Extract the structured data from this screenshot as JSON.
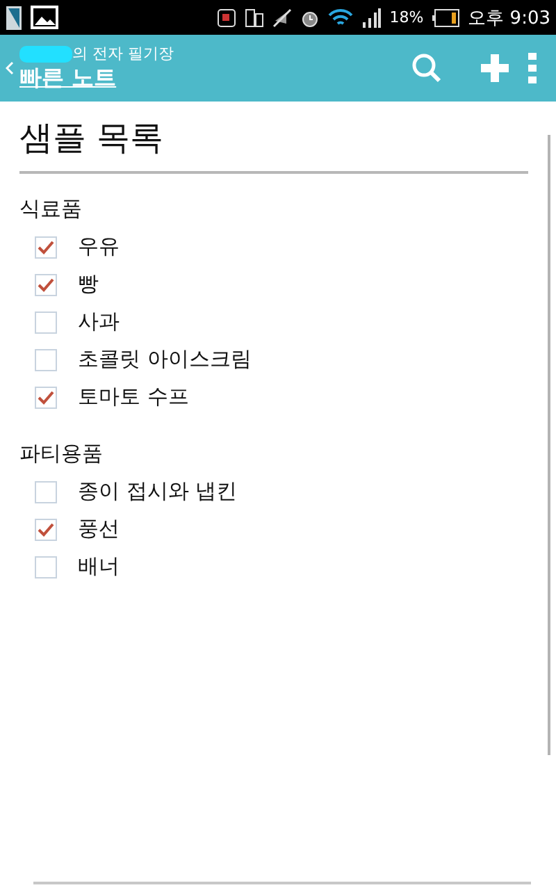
{
  "status_bar": {
    "battery": "18%",
    "time": "오후 9:03"
  },
  "app_bar": {
    "subtitle": "의 전자 필기장",
    "title": "빠른 노트"
  },
  "page": {
    "title": "샘플 목록"
  },
  "sections": [
    {
      "heading": "식료품",
      "items": [
        {
          "label": "우유",
          "checked": true
        },
        {
          "label": "빵",
          "checked": true
        },
        {
          "label": "사과",
          "checked": false
        },
        {
          "label": "초콜릿 아이스크림",
          "checked": false
        },
        {
          "label": "토마토 수프",
          "checked": true
        }
      ]
    },
    {
      "heading": "파티용품",
      "items": [
        {
          "label": "종이 접시와 냅킨",
          "checked": false
        },
        {
          "label": "풍선",
          "checked": true
        },
        {
          "label": "배너",
          "checked": false
        }
      ]
    }
  ]
}
